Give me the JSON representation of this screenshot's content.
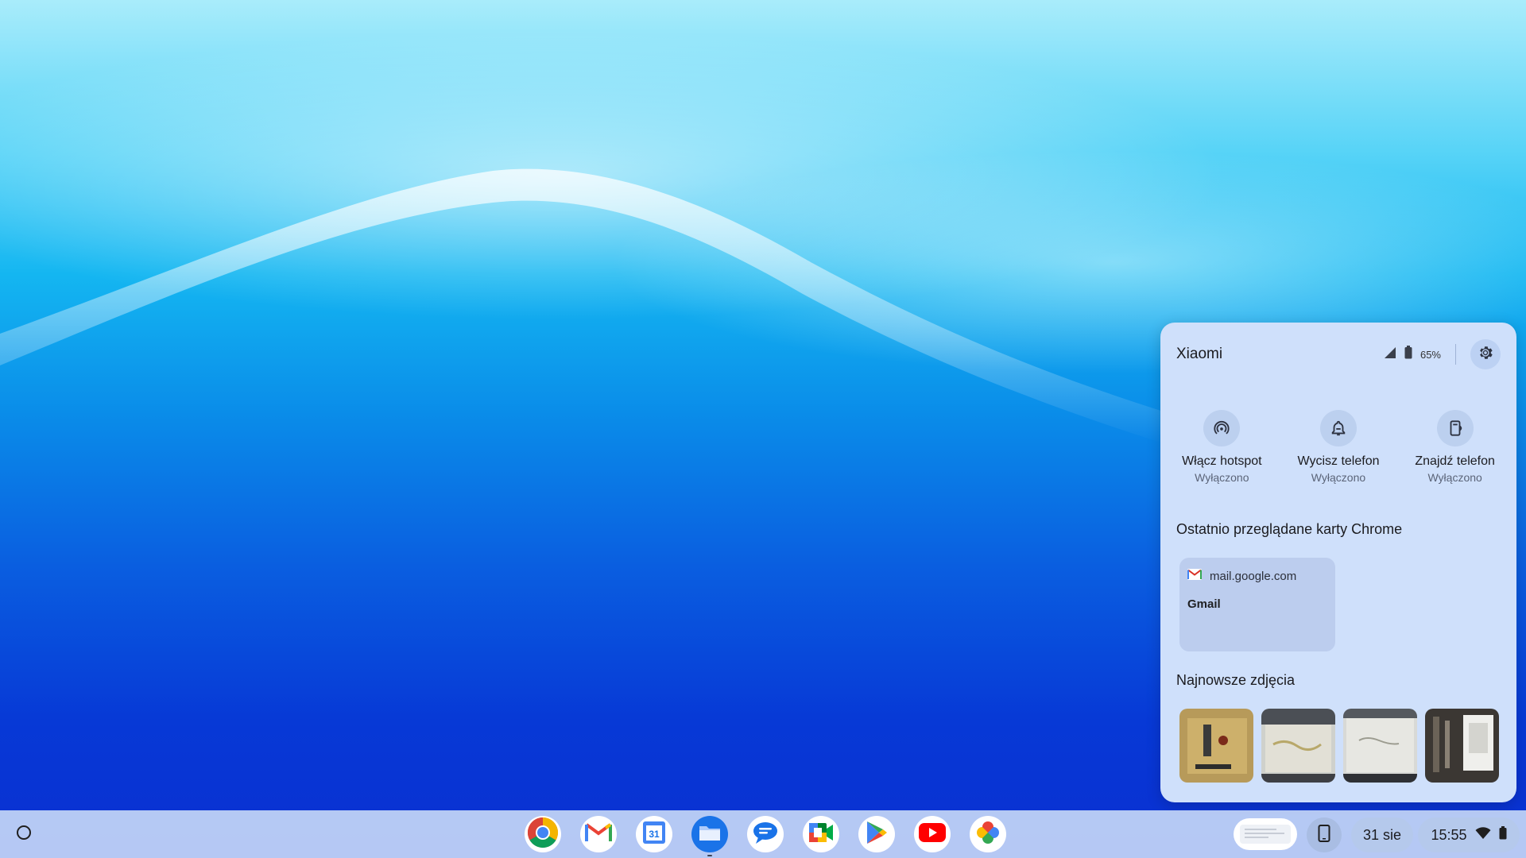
{
  "phone_hub": {
    "device_name": "Xiaomi",
    "battery_percent": "65%",
    "quick_actions": [
      {
        "label": "Włącz hotspot",
        "status": "Wyłączono",
        "icon": "hotspot-icon"
      },
      {
        "label": "Wycisz telefon",
        "status": "Wyłączono",
        "icon": "silence-bell-icon"
      },
      {
        "label": "Znajdź telefon",
        "status": "Wyłączono",
        "icon": "find-phone-icon"
      }
    ],
    "recent_tabs_title": "Ostatnio przeglądane karty Chrome",
    "recent_tab": {
      "url": "mail.google.com",
      "title": "Gmail"
    },
    "photos_title": "Najnowsze zdjęcia",
    "photos": [
      "photo-1",
      "photo-2",
      "photo-3",
      "photo-4"
    ]
  },
  "shelf": {
    "apps": [
      "chrome",
      "gmail",
      "calendar",
      "files",
      "messages",
      "meet",
      "play-store",
      "youtube",
      "photos"
    ],
    "calendar_day": "31",
    "date": "31 sie",
    "time": "15:55"
  },
  "colors": {
    "panel_bg": "#cfe0fb",
    "shelf_bg": "#c4d6f6"
  }
}
